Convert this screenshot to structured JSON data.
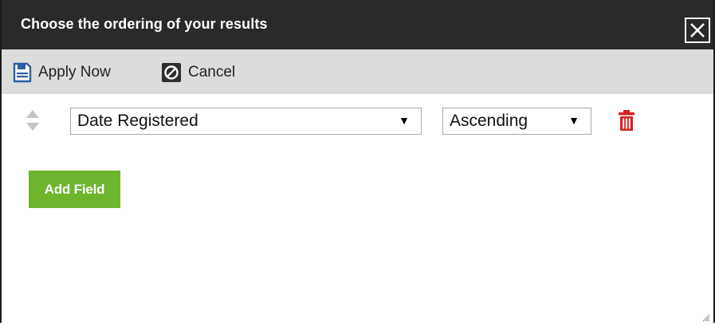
{
  "dialog": {
    "title": "Choose the ordering of your results",
    "close_icon": "close-icon"
  },
  "toolbar": {
    "apply_label": "Apply Now",
    "apply_icon": "save-icon",
    "cancel_label": "Cancel",
    "cancel_icon": "cancel-icon"
  },
  "sort_rows": [
    {
      "field": "Date Registered",
      "direction": "Ascending",
      "drag_icon": "drag-handle-icon",
      "delete_icon": "trash-icon"
    }
  ],
  "add_field_label": "Add Field",
  "colors": {
    "titlebar": "#2a2a2a",
    "toolbar": "#dcdcdc",
    "accent_blue": "#2b5fa6",
    "delete_red": "#d62222",
    "add_green": "#6cb52d"
  }
}
